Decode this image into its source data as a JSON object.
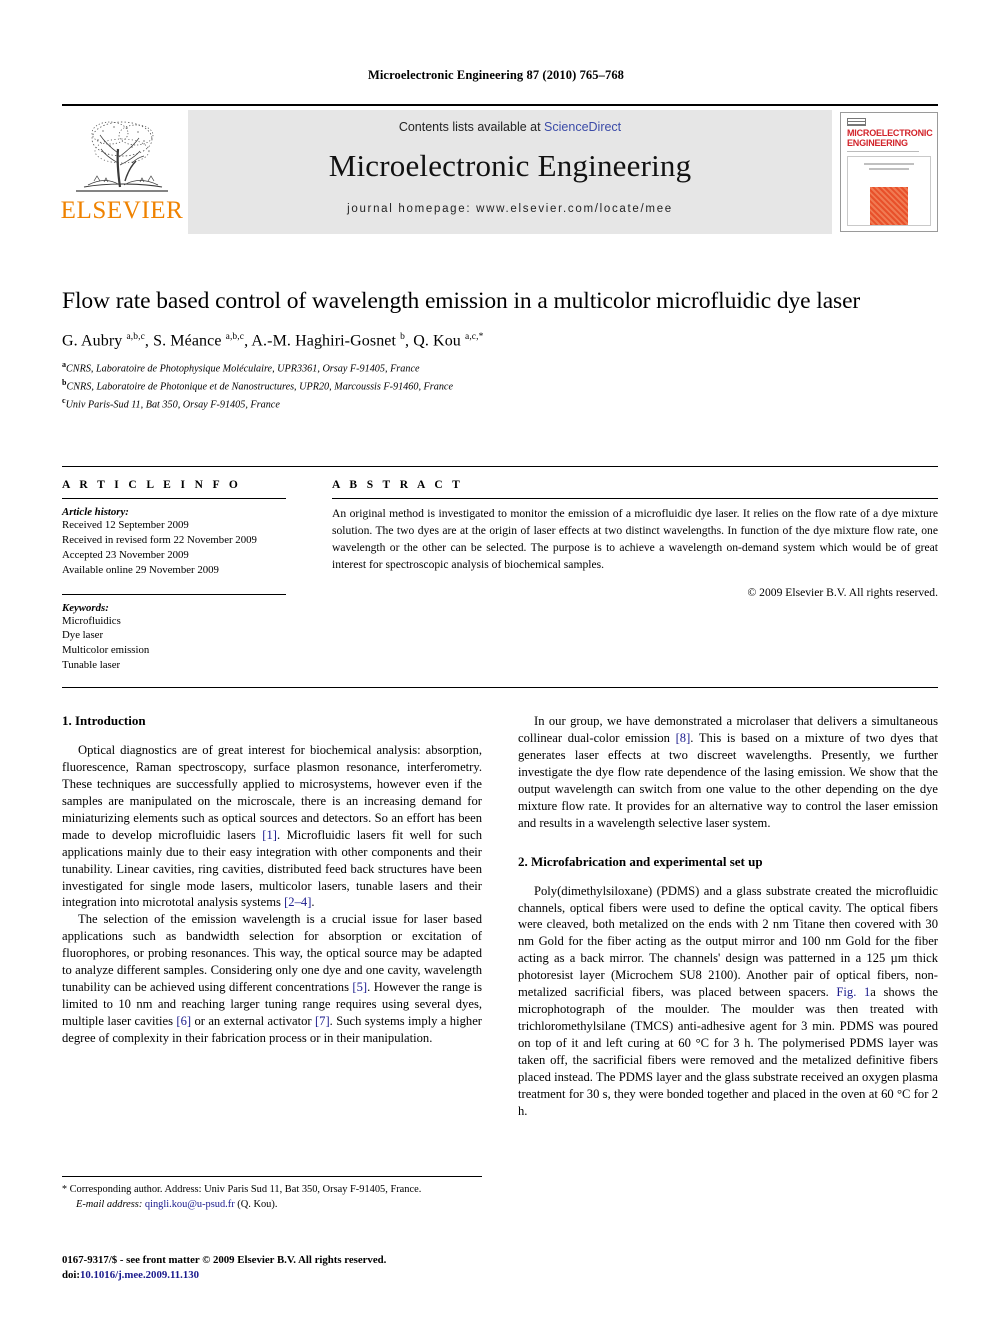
{
  "running_head": "Microelectronic Engineering 87 (2010) 765–768",
  "masthead": {
    "publisher_name": "ELSEVIER",
    "contents_prefix": "Contents lists available at ",
    "sciencedirect": "ScienceDirect",
    "journal_title": "Microelectronic Engineering",
    "homepage": "journal homepage: www.elsevier.com/locate/mee",
    "cover": {
      "title_line1": "MICROELECTRONIC",
      "title_line2": "ENGINEERING"
    },
    "colors": {
      "elsevier_orange": "#ef8200",
      "link_blue": "#3b4ba8",
      "cover_red": "#d2232a",
      "banner_gray": "#e6e6e6"
    }
  },
  "article": {
    "title": "Flow rate based control of wavelength emission in a multicolor microfluidic dye laser",
    "authors_html": "G. Aubry <sup>a,b,c</sup>, S. Méance <sup>a,b,c</sup>, A.-M. Haghiri-Gosnet <sup>b</sup>, Q. Kou <sup>a,c,</sup><sup>*</sup>",
    "authors_plain": "G. Aubry a,b,c, S. Méance a,b,c, A.-M. Haghiri-Gosnet b, Q. Kou a,c,*",
    "affiliations": [
      {
        "marker": "a",
        "text": "CNRS, Laboratoire de Photophysique Moléculaire, UPR3361, Orsay F-91405, France"
      },
      {
        "marker": "b",
        "text": "CNRS, Laboratoire de Photonique et de Nanostructures, UPR20, Marcoussis F-91460, France"
      },
      {
        "marker": "c",
        "text": "Univ Paris-Sud 11, Bat 350, Orsay F-91405, France"
      }
    ]
  },
  "article_info": {
    "heading": "A R T I C L E   I N F O",
    "history_label": "Article history:",
    "history": [
      "Received 12 September 2009",
      "Received in revised form 22 November 2009",
      "Accepted 23 November 2009",
      "Available online 29 November 2009"
    ],
    "keywords_label": "Keywords:",
    "keywords": [
      "Microfluidics",
      "Dye laser",
      "Multicolor emission",
      "Tunable laser"
    ]
  },
  "abstract": {
    "heading": "A B S T R A C T",
    "text": "An original method is investigated to monitor the emission of a microfluidic dye laser. It relies on the flow rate of a dye mixture solution. The two dyes are at the origin of laser effects at two distinct wavelengths. In function of the dye mixture flow rate, one wavelength or the other can be selected. The purpose is to achieve a wavelength on-demand system which would be of great interest for spectroscopic analysis of biochemical samples.",
    "copyright": "© 2009 Elsevier B.V. All rights reserved."
  },
  "body": {
    "left_column": {
      "section_heading": "1. Introduction",
      "paragraphs": [
        "Optical diagnostics are of great interest for biochemical analysis: absorption, fluorescence, Raman spectroscopy, surface plasmon resonance, interferometry. These techniques are successfully applied to microsystems, however even if the samples are manipulated on the microscale, there is an increasing demand for miniaturizing elements such as optical sources and detectors. So an effort has been made to develop microfluidic lasers [1]. Microfluidic lasers fit well for such applications mainly due to their easy integration with other components and their tunability. Linear cavities, ring cavities, distributed feed back structures have been investigated for single mode lasers, multicolor lasers, tunable lasers and their integration into micrototal analysis systems [2–4].",
        "The selection of the emission wavelength is a crucial issue for laser based applications such as bandwidth selection for absorption or excitation of fluorophores, or probing resonances. This way, the optical source may be adapted to analyze different samples. Considering only one dye and one cavity, wavelength tunability can be achieved using different concentrations [5]. However the range is limited to 10 nm and reaching larger tuning range requires using several dyes, multiple laser cavities [6] or an external activator [7]. Such systems imply a higher degree of complexity in their fabrication process or in their manipulation."
      ]
    },
    "right_column": {
      "paragraph_1": "In our group, we have demonstrated a microlaser that delivers a simultaneous collinear dual-color emission [8]. This is based on a mixture of two dyes that generates laser effects at two discreet wavelengths. Presently, we further investigate the dye flow rate dependence of the lasing emission. We show that the output wavelength can switch from one value to the other depending on the dye mixture flow rate. It provides for an alternative way to control the laser emission and results in a wavelength selective laser system.",
      "section_heading": "2. Microfabrication and experimental set up",
      "paragraph_2": "Poly(dimethylsiloxane) (PDMS) and a glass substrate created the microfluidic channels, optical fibers were used to define the optical cavity. The optical fibers were cleaved, both metalized on the ends with 2 nm Titane then covered with 30 nm Gold for the fiber acting as the output mirror and 100 nm Gold for the fiber acting as a back mirror. The channels' design was patterned in a 125 µm thick photoresist layer (Microchem SU8 2100). Another pair of optical fibers, non-metalized sacrificial fibers, was placed between spacers. Fig. 1a shows the microphotograph of the moulder. The moulder was then treated with trichloromethylsilane (TMCS) anti-adhesive agent for 3 min. PDMS was poured on top of it and left curing at 60 °C for 3 h. The polymerised PDMS layer was taken off, the sacrificial fibers were removed and the metalized definitive fibers placed instead. The PDMS layer and the glass substrate received an oxygen plasma treatment for 30 s, they were bonded together and placed in the oven at 60 °C for 2 h."
    }
  },
  "footnote": {
    "star": "*",
    "corresponding": " Corresponding author. Address: Univ Paris Sud 11, Bat 350, Orsay F-91405, France.",
    "email_label": "E-mail address:",
    "email": "qingli.kou@u-psud.fr",
    "email_suffix": " (Q. Kou)."
  },
  "imprint": {
    "issn_line": "0167-9317/$ - see front matter © 2009 Elsevier B.V. All rights reserved.",
    "doi_prefix": "doi:",
    "doi": "10.1016/j.mee.2009.11.130"
  },
  "references_inline": {
    "r1": "[1]",
    "r2_4": "[2–4]",
    "r5": "[5]",
    "r6": "[6]",
    "r7": "[7]",
    "r8": "[8]",
    "fig1a": "Fig. 1"
  }
}
